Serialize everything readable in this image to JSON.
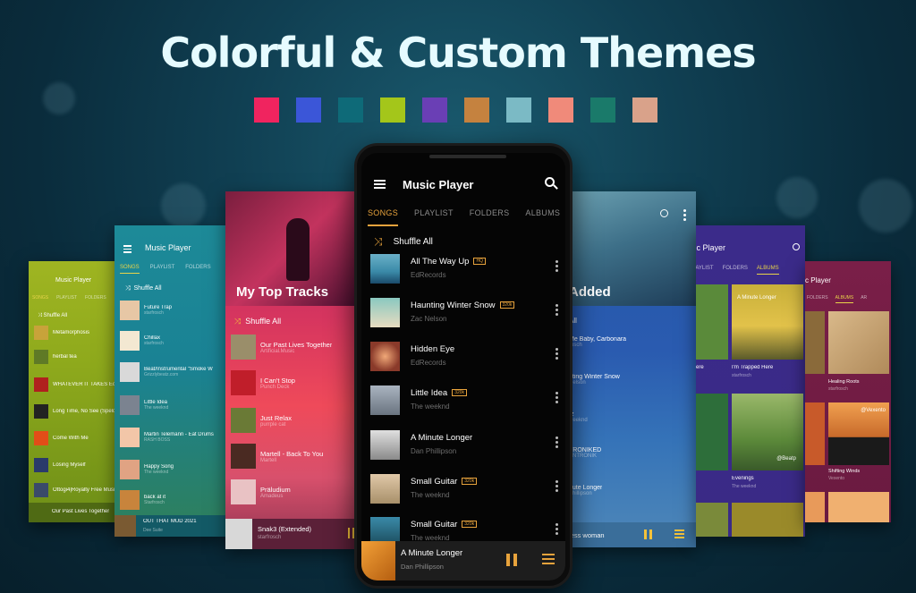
{
  "headline": "Colorful &  Custom Themes",
  "swatch_colors": [
    "#f0245f",
    "#3b56d8",
    "#0e6a78",
    "#a4c61a",
    "#6a3fb5",
    "#c5823f",
    "#7bbac5",
    "#f08a7a",
    "#1a7a6a",
    "#d9a28a"
  ],
  "main_phone": {
    "title": "Music Player",
    "tabs": [
      "SONGS",
      "PLAYLIST",
      "FOLDERS",
      "ALBUMS",
      "AR"
    ],
    "shuffle_label": "Shuffle All",
    "songs": [
      {
        "title": "All The Way Up",
        "artist": "EdRecords",
        "badge": "HQ"
      },
      {
        "title": "Haunting Winter Snow",
        "artist": "Zac Nelson",
        "badge": "320k"
      },
      {
        "title": "Hidden Eye",
        "artist": "EdRecords",
        "badge": ""
      },
      {
        "title": "Little Idea",
        "artist": "The weeknd",
        "badge": "320k"
      },
      {
        "title": "A Minute Longer",
        "artist": "Dan Phillipson",
        "badge": ""
      },
      {
        "title": "Small Guitar",
        "artist": "The weeknd",
        "badge": "320k"
      },
      {
        "title": "Small Guitar",
        "artist": "The weeknd",
        "badge": "320k"
      }
    ],
    "now_playing": {
      "title": "A Minute Longer",
      "artist": "Dan Phillipson"
    }
  },
  "lime_card": {
    "title": "Music Player",
    "tabs": [
      "SONGS",
      "PLAYLIST",
      "FOLDERS"
    ],
    "shuffle_label": "Shuffle All",
    "songs": [
      "Metamorphosis",
      "herbal tea",
      "WHATEVER IT TAKES Ecoh",
      "Long Time, No See (Speld",
      "Come With Me",
      "Losing Myself",
      "Ottogi4|Royalty Free Music"
    ],
    "now_playing": "Our Past Lives Together"
  },
  "teal_card": {
    "title": "Music Player",
    "tabs": [
      "SONGS",
      "PLAYLIST",
      "FOLDERS"
    ],
    "shuffle_label": "Shuffle All",
    "songs": [
      {
        "title": "Future Trap",
        "sub": "starfrosch"
      },
      {
        "title": "Chillax",
        "sub": "starfrosch"
      },
      {
        "title": "Beat/Instrumental \"Smoke W",
        "sub": "Grizzlybeatz.com"
      },
      {
        "title": "Little Idea",
        "sub": "The weeknd"
      },
      {
        "title": "Martin Telemann - Eat Drums",
        "sub": "RASH BOSS"
      },
      {
        "title": "Happy Song",
        "sub": "The weeknd"
      },
      {
        "title": "back at it",
        "sub": "Starfrosch"
      }
    ],
    "now_playing": {
      "title": "OUT THAT MUD 2021",
      "sub": "Dee Suite"
    }
  },
  "pink_card": {
    "header": "My Top Tracks",
    "shuffle_label": "Shuffle All",
    "songs": [
      {
        "title": "Our Past Lives Together",
        "sub": "Artificial.Music"
      },
      {
        "title": "I Can't Stop",
        "sub": "Punch Deck"
      },
      {
        "title": "Just Relax",
        "sub": "purrple cat"
      },
      {
        "title": "Martell - Back To You",
        "sub": "Martell"
      },
      {
        "title": "Präludium",
        "sub": "Amadeus"
      }
    ],
    "now_playing": {
      "title": "Snak3 (Extended)",
      "sub": "starfrosch"
    }
  },
  "blue_card": {
    "header": "Added",
    "shuffle_label": "All",
    "songs": [
      {
        "title": "Me Baby, Carbonara",
        "sub": "rosch"
      },
      {
        "title": "nting Winter Snow",
        "sub": "Nelson"
      },
      {
        "title": "tz",
        "sub": "weeknd"
      },
      {
        "title": "TRONIKED",
        "sub": "YNTRONIK"
      },
      {
        "title": "nute Longer",
        "sub": "Phillipson"
      }
    ],
    "now_playing": "less woman"
  },
  "violet_card": {
    "title": "sic Player",
    "tabs": [
      "LAYLIST",
      "FOLDERS",
      "ALBUMS"
    ],
    "albums": [
      {
        "title": "ere",
        "sub": ""
      },
      {
        "title": "I'm Trapped Here",
        "sub": "starfrosch"
      },
      {
        "title": "",
        "sub": ""
      },
      {
        "title": "Evenings",
        "sub": "The weeknd"
      }
    ],
    "album_overlays": [
      "A Minute Longer",
      "@Beatp"
    ]
  },
  "maroon_card": {
    "title": "c Player",
    "tabs": [
      "FOLDERS",
      "ALBUMS",
      "AR"
    ],
    "albums": [
      {
        "title": "Healing Roots",
        "sub": "starfrosch"
      },
      {
        "title": "Shifting Winds",
        "sub": "Vexento"
      }
    ],
    "album_overlays": [
      "@Vexento"
    ]
  }
}
